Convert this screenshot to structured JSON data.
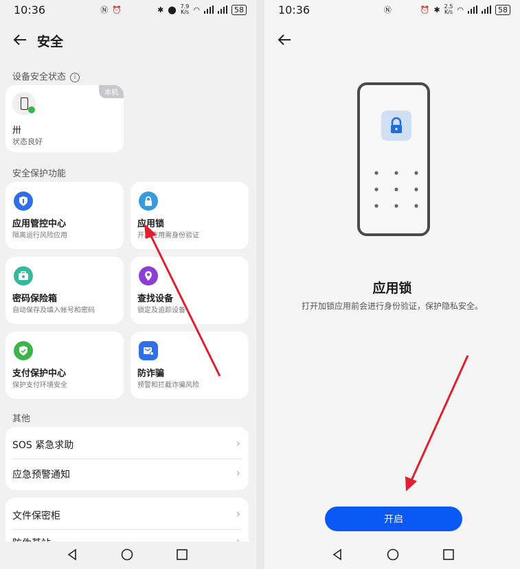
{
  "left": {
    "status": {
      "time": "10:36",
      "netspeed": "7.9\nK/s",
      "battery": "58"
    },
    "title": "安全",
    "device_section": "设备安全状态",
    "device": {
      "tag": "本机",
      "name": "卅",
      "status": "状态良好"
    },
    "protection_section": "安全保护功能",
    "features": [
      {
        "name": "应用管控中心",
        "desc": "隔离运行风险应用",
        "color": "#2f6fe8"
      },
      {
        "name": "应用锁",
        "desc": "开启应用需身份验证",
        "color": "#3a9ae0"
      },
      {
        "name": "密码保险箱",
        "desc": "自动保存及填入帐号和密码",
        "color": "#36b89a"
      },
      {
        "name": "查找设备",
        "desc": "锁定及追踪设备",
        "color": "#8b3fd6"
      },
      {
        "name": "支付保护中心",
        "desc": "保护支付环境安全",
        "color": "#3bb54a"
      },
      {
        "name": "防诈骗",
        "desc": "预警和拦截诈骗风险",
        "color": "#2f6fe8"
      }
    ],
    "other_section": "其他",
    "other_rows": [
      "SOS 紧急求助",
      "应急预警通知"
    ],
    "more_rows": [
      "文件保密柜",
      "防伪基站"
    ]
  },
  "right": {
    "status": {
      "time": "10:36",
      "netspeed": "2.5\nK/s",
      "battery": "58"
    },
    "heading": "应用锁",
    "description": "打开加锁应用前会进行身份验证，保护隐私安全。",
    "button": "开启",
    "accent": "#0a59f7"
  },
  "annotation_color": "#e02030"
}
